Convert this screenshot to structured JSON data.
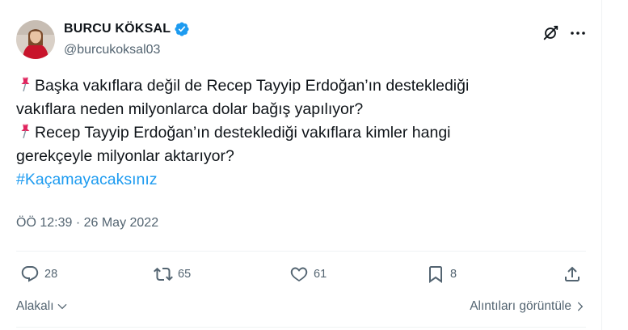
{
  "author": {
    "display_name": "BURCU KÖKSAL",
    "handle": "@burcukoksal03",
    "verified_icon": "verified-badge-icon",
    "avatar_icon": "avatar-photo"
  },
  "header_actions": {
    "grok_icon": "grok-icon",
    "more_icon": "more-options-icon"
  },
  "tweet": {
    "line1": "Başka vakıflara değil de Recep Tayyip Erdoğan’ın desteklediği",
    "line2": "vakıflara neden milyonlarca dolar bağış yapılıyor?",
    "line3": "Recep Tayyip Erdoğan’ın desteklediği vakıflara kimler hangi",
    "line4": "gerekçeyle milyonlar aktarıyor?",
    "hashtag": "#Kaçamayacaksınız",
    "pin_icon": "pushpin-emoji-icon"
  },
  "timestamp": "ÖÖ 12:39 · 26 May 2022",
  "actions": {
    "replies": "28",
    "retweets": "65",
    "likes": "61",
    "bookmarks": "8"
  },
  "footer": {
    "sort_label": "Alakalı",
    "quotes_label": "Alıntıları görüntüle"
  },
  "colors": {
    "text": "#0f1419",
    "secondary": "#536471",
    "accent": "#1d9bf0",
    "pin": "#e0245e"
  }
}
